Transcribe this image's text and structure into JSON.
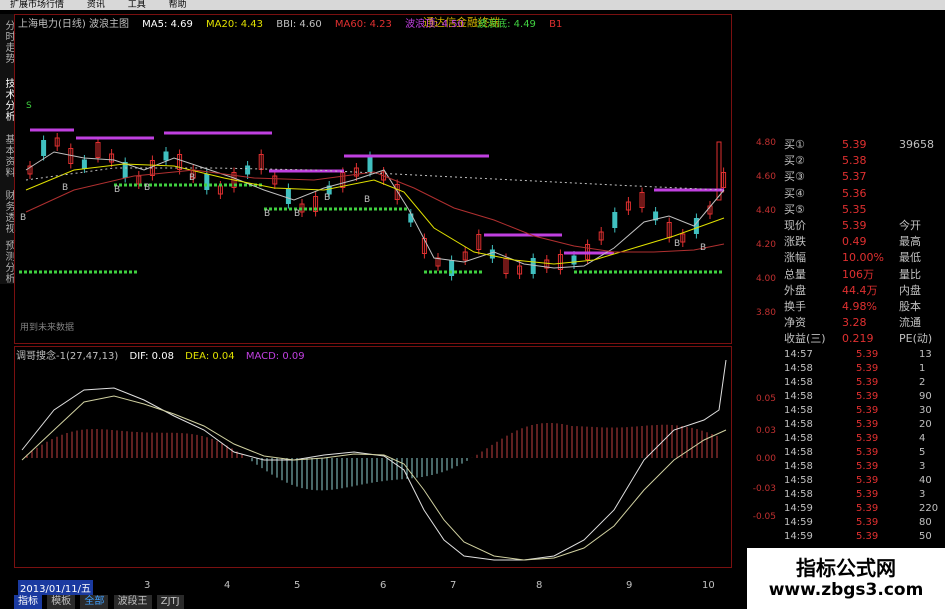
{
  "menu": [
    "扩展市场行情",
    "资讯",
    "工具",
    "帮助"
  ],
  "banner": "通达信金融终端",
  "left_tabs": [
    "分时走势",
    "技术分析",
    "基本资料",
    "财务透视",
    "预测分析"
  ],
  "price_header": {
    "title": "上海电力(日线) 波浪主图",
    "ma5": "MA5: 4.69",
    "ma20": "MA20: 4.43",
    "bbi": "BBI: 4.60",
    "ma60": "MA60: 4.23",
    "wave_top": "波浪顶: 4.50",
    "wave_bottom": "波浪底: 4.49",
    "b1": "B1"
  },
  "future_data_label": "用到未来数据",
  "price_ticks": [
    "4.80",
    "4.60",
    "4.40",
    "4.20",
    "4.00",
    "3.80"
  ],
  "order_book": [
    {
      "l": "买①",
      "v": "5.39",
      "r": "39658"
    },
    {
      "l": "买②",
      "v": "5.38",
      "r": ""
    },
    {
      "l": "买③",
      "v": "5.37",
      "r": ""
    },
    {
      "l": "买④",
      "v": "5.36",
      "r": ""
    },
    {
      "l": "买⑤",
      "v": "5.35",
      "r": ""
    },
    {
      "l": "现价",
      "v": "5.39",
      "r": "今开"
    },
    {
      "l": "涨跌",
      "v": "0.49",
      "r": "最高"
    },
    {
      "l": "涨幅",
      "v": "10.00%",
      "r": "最低"
    },
    {
      "l": "总量",
      "v": "106万",
      "r": "量比"
    },
    {
      "l": "外盘",
      "v": "44.4万",
      "r": "内盘"
    },
    {
      "l": "换手",
      "v": "4.98%",
      "r": "股本"
    },
    {
      "l": "净资",
      "v": "3.28",
      "r": "流通"
    },
    {
      "l": "收益(三)",
      "v": "0.219",
      "r": "PE(动)"
    }
  ],
  "trades": [
    {
      "t": "14:57",
      "p": "5.39",
      "q": "13"
    },
    {
      "t": "14:58",
      "p": "5.39",
      "q": "1"
    },
    {
      "t": "14:58",
      "p": "5.39",
      "q": "2"
    },
    {
      "t": "14:58",
      "p": "5.39",
      "q": "90"
    },
    {
      "t": "14:58",
      "p": "5.39",
      "q": "30"
    },
    {
      "t": "14:58",
      "p": "5.39",
      "q": "20"
    },
    {
      "t": "14:58",
      "p": "5.39",
      "q": "4"
    },
    {
      "t": "14:58",
      "p": "5.39",
      "q": "5"
    },
    {
      "t": "14:58",
      "p": "5.39",
      "q": "3"
    },
    {
      "t": "14:58",
      "p": "5.39",
      "q": "40"
    },
    {
      "t": "14:58",
      "p": "5.39",
      "q": "3"
    },
    {
      "t": "14:59",
      "p": "5.39",
      "q": "220"
    },
    {
      "t": "14:59",
      "p": "5.39",
      "q": "80"
    },
    {
      "t": "14:59",
      "p": "5.39",
      "q": "50"
    }
  ],
  "macd_header": {
    "name": "调哥搜念-1(27,47,13)",
    "dif": "DIF: 0.08",
    "dea": "DEA: 0.04",
    "macd": "MACD: 0.09"
  },
  "macd_ticks": [
    "0.05",
    "0.03",
    "0.00",
    "-0.03",
    "-0.05"
  ],
  "date_box": "2013/01/11/五",
  "date_ticks": [
    "3",
    "4",
    "5",
    "6",
    "7",
    "8",
    "9",
    "10"
  ],
  "bottom_tabs": [
    "指标",
    "模板",
    "全部",
    "波段王",
    "ZJTJ"
  ],
  "watermark": {
    "line1": "指标公式网",
    "line2": "www.zbgs3.com"
  },
  "colors": {
    "up": "#e03030",
    "down": "#40c0c0",
    "wave": "#c040e0",
    "support": "#40d040",
    "ma": "#c0c0c0"
  }
}
